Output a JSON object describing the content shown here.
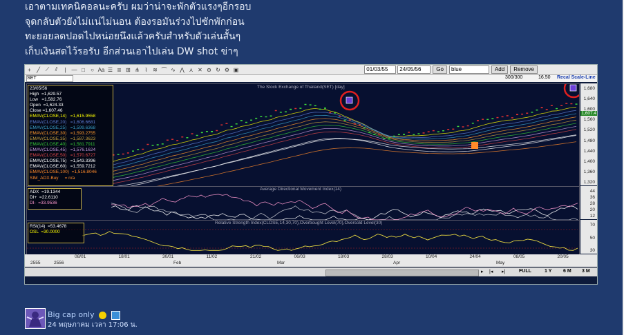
{
  "post": {
    "lines": [
      "เอาตามเทคนิคอลนะครับ ผมว่าน่าจะพักตัวแรงๆอีกรอบ",
      "จุดกลับตัวยังไม่แน่ไม่นอน ต้องรอมันร่วงไปซักพักก่อน",
      "ทะยอยลดปอดไปหน่อยนึงแล้วครับสำหรับตัวเล่นสั้นๆ",
      "เก็บเงินสดไว้รอรับ อีกส่วนเอาไปเล่น DW shot ข่าๆ"
    ]
  },
  "toolbar": {
    "date_from": "01/03/55",
    "date_to": "24/05/56",
    "go_label": "Go",
    "color_value": "blue",
    "add_label": "Add",
    "remove_label": "Remove",
    "symbol": "SET",
    "counter": "300/300",
    "price_step": "16.50",
    "recal_label": "Recal Scale-Line"
  },
  "main_panel": {
    "title": "The Stock Exchange of Thailand(SET) [day]",
    "legend": [
      {
        "text": "23/05/56",
        "color": "#ffffff"
      },
      {
        "text": "High  =1,629.57",
        "color": "#ffffff"
      },
      {
        "text": "Low   =1,582.76",
        "color": "#ffffff"
      },
      {
        "text": "Open  =1,624.33",
        "color": "#ffffff"
      },
      {
        "text": "Close =1,607.46",
        "color": "#ffffff"
      },
      {
        "text": "EMAV(CLOSE,14)   =1,615.9558",
        "color": "#ffff00"
      },
      {
        "text": "EMAV(CLOSE,20)   =1,606.6681",
        "color": "#5e7fd8"
      },
      {
        "text": "EMAV(CLOSE,25)   =1,599.6368",
        "color": "#3aa0c8"
      },
      {
        "text": "EMAV(CLOSE,30)   =1,593.2755",
        "color": "#ff9a2e"
      },
      {
        "text": "EMAV(CLOSE,35)   =1,587.3623",
        "color": "#c8a03c"
      },
      {
        "text": "EMAV(CLOSE,40)   =1,581.7911",
        "color": "#37c837"
      },
      {
        "text": "EMAV(CLOSE,45)   =1,576.1624",
        "color": "#c89ae0"
      },
      {
        "text": "EMAV(CLOSE,50)   =1,570.6727",
        "color": "#e04848"
      },
      {
        "text": "EMAV(CLOSE,75)   =1,543.3396",
        "color": "#ffffff"
      },
      {
        "text": "EMAV(CLOSE,60)   =1,559.7212",
        "color": "#ffffff"
      },
      {
        "text": "EMAV(CLOSE,100)  =1,516.8046",
        "color": "#ff8a2a"
      },
      {
        "text": "SIM_ADX.Buy     = n/a",
        "color": "#ff8a2a"
      }
    ],
    "yticks": [
      "1,680",
      "1,640",
      "1,600",
      "1,560",
      "1,520",
      "1,480",
      "1,440",
      "1,400",
      "1,360",
      "1,320"
    ],
    "last_price": "1,607.4"
  },
  "adx_panel": {
    "title": "Average Directional Movement Index(14)",
    "legend": [
      {
        "text": "ADX  =19.1344",
        "color": "#ffffff"
      },
      {
        "text": "DI+  =22.6110",
        "color": "#ffffff"
      },
      {
        "text": "DI-  =33.9536",
        "color": "#ff9ad0"
      }
    ],
    "yticks": [
      "44",
      "36",
      "28",
      "20",
      "12"
    ]
  },
  "rsi_panel": {
    "title": "Relative Strength Index(CLOSE,14,30,70),Overbought Level(70),Oversold Level(30)",
    "legend": [
      {
        "text": "RSI(14)  =53.4678",
        "color": "#ffffff"
      },
      {
        "text": "OSL  =30.0000",
        "color": "#ffff00"
      }
    ],
    "yticks": [
      "70",
      "50",
      "30"
    ]
  },
  "xaxis": {
    "days": [
      "08/01",
      "18/01",
      "30/01",
      "11/02",
      "21/02",
      "06/03",
      "18/03",
      "28/03",
      "10/04",
      "24/04",
      "08/05",
      "20/05"
    ],
    "years": [
      "2555",
      "2556"
    ],
    "months": [
      "Feb",
      "Mar",
      "Apr",
      "May"
    ]
  },
  "bottombar": {
    "full_label": "FULL",
    "r1y": "1 Y",
    "r6m": "6 M",
    "r3m": "3 M"
  },
  "footer": {
    "author": "Big cap only",
    "date": "24 พฤษภาคม เวลา 17:06 น."
  },
  "colors": {
    "page_bg": "#1f3a6e",
    "chart_bg": "#071030",
    "candle_up": "#3dd83d",
    "candle_down": "#e03030",
    "highlight_circle": "#e02020"
  }
}
